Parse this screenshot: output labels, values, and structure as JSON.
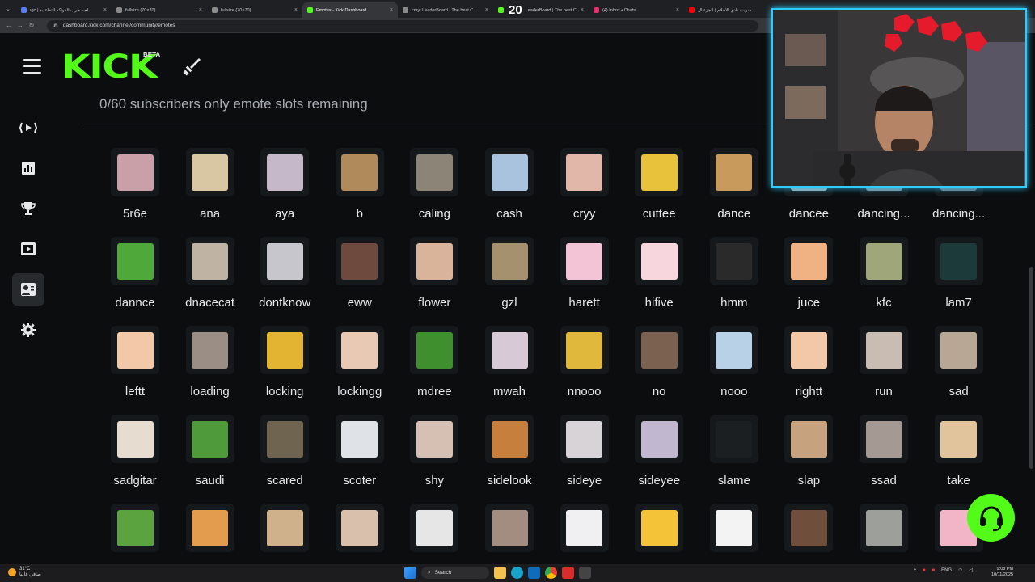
{
  "browser": {
    "tabs": [
      {
        "title": "ıgo | لعبه حرب الفواكه التفاعليه",
        "active": false,
        "color": "#5b7cfa"
      },
      {
        "title": "fullsize (70×70)",
        "active": false,
        "color": "#8a8a8a"
      },
      {
        "title": "fullsize (70×70)",
        "active": false,
        "color": "#8a8a8a"
      },
      {
        "title": "Emotes - Kick Dashboard",
        "active": true,
        "color": "#53fc18"
      },
      {
        "title": "cmyt LeaderBoard | The best C",
        "active": false,
        "color": "#8a8a8a"
      },
      {
        "title": "LeaderBoard | The best C",
        "active": false,
        "color": "#53fc18",
        "badge": "20"
      },
      {
        "title": "(4) Inbox • Chats",
        "active": false,
        "color": "#e1306c"
      },
      {
        "title": "سويت نادي الاحلام | الجزء ال",
        "active": false,
        "color": "#ff0000"
      }
    ],
    "url": "dashboard.kick.com/channel/community/emotes"
  },
  "header": {
    "logo": "KICK",
    "beta": "BETA"
  },
  "sidebar": {
    "items": [
      {
        "name": "stream-icon",
        "active": false
      },
      {
        "name": "analytics-icon",
        "active": false
      },
      {
        "name": "trophy-icon",
        "active": false
      },
      {
        "name": "video-icon",
        "active": false
      },
      {
        "name": "community-icon",
        "active": true
      },
      {
        "name": "gear-icon",
        "active": false
      }
    ]
  },
  "main": {
    "slots_text": "0/60 subscribers only emote slots remaining",
    "emotes": [
      {
        "label": "5r6e",
        "color": "#c9a0a8"
      },
      {
        "label": "ana",
        "color": "#d9c6a2"
      },
      {
        "label": "aya",
        "color": "#c4b8c9"
      },
      {
        "label": "b",
        "color": "#b08a5a"
      },
      {
        "label": "caling",
        "color": "#8c8476"
      },
      {
        "label": "cash",
        "color": "#a9c2dd"
      },
      {
        "label": "cryy",
        "color": "#e0b7a8"
      },
      {
        "label": "cuttee",
        "color": "#e8c23a"
      },
      {
        "label": "dance",
        "color": "#c89a5c"
      },
      {
        "label": "dancee",
        "color": "#9aa7b3"
      },
      {
        "label": "dancing...",
        "color": "#7f8c99"
      },
      {
        "label": "dancing...",
        "color": "#6a7580"
      },
      {
        "label": "dannce",
        "color": "#4fa83a"
      },
      {
        "label": "dnacecat",
        "color": "#bfb4a3"
      },
      {
        "label": "dontknow",
        "color": "#c6c6cc"
      },
      {
        "label": "eww",
        "color": "#6e4a3e"
      },
      {
        "label": "flower",
        "color": "#d9b49a"
      },
      {
        "label": "gzl",
        "color": "#a5916e"
      },
      {
        "label": "harett",
        "color": "#f3c4d5"
      },
      {
        "label": "hifive",
        "color": "#f7d7dd"
      },
      {
        "label": "hmm",
        "color": "#2a2a2a"
      },
      {
        "label": "juce",
        "color": "#f0b283"
      },
      {
        "label": "kfc",
        "color": "#9ea67a"
      },
      {
        "label": "lam7",
        "color": "#1c3a3a"
      },
      {
        "label": "leftt",
        "color": "#f2c9a8"
      },
      {
        "label": "loading",
        "color": "#9b8f85"
      },
      {
        "label": "locking",
        "color": "#e2b431"
      },
      {
        "label": "lockingg",
        "color": "#e8c9b3"
      },
      {
        "label": "mdree",
        "color": "#3f8f2f"
      },
      {
        "label": "mwah",
        "color": "#d7c9d6"
      },
      {
        "label": "nnooo",
        "color": "#e0b93c"
      },
      {
        "label": "no",
        "color": "#7a6150"
      },
      {
        "label": "nooo",
        "color": "#b9d1e7"
      },
      {
        "label": "rightt",
        "color": "#f2c9a8"
      },
      {
        "label": "run",
        "color": "#c9bcb3"
      },
      {
        "label": "sad",
        "color": "#b9a796"
      },
      {
        "label": "sadgitar",
        "color": "#e6dccf"
      },
      {
        "label": "saudi",
        "color": "#4f9a3b"
      },
      {
        "label": "scared",
        "color": "#6e6450"
      },
      {
        "label": "scoter",
        "color": "#dfe3e8"
      },
      {
        "label": "shy",
        "color": "#d6bfb3"
      },
      {
        "label": "sidelook",
        "color": "#c67f3c"
      },
      {
        "label": "sideye",
        "color": "#d8d3d6"
      },
      {
        "label": "sideyee",
        "color": "#c1b7cf"
      },
      {
        "label": "slame",
        "color": "#1c1f21"
      },
      {
        "label": "slap",
        "color": "#c6a27e"
      },
      {
        "label": "ssad",
        "color": "#a59a93"
      },
      {
        "label": "take",
        "color": "#e2c49c"
      },
      {
        "label": "",
        "color": "#5aa33f"
      },
      {
        "label": "",
        "color": "#e39c4d"
      },
      {
        "label": "",
        "color": "#cfb28b"
      },
      {
        "label": "",
        "color": "#d9c0ad"
      },
      {
        "label": "",
        "color": "#e6e6e6"
      },
      {
        "label": "",
        "color": "#a38d80"
      },
      {
        "label": "",
        "color": "#f0f0f3"
      },
      {
        "label": "",
        "color": "#f4c338"
      },
      {
        "label": "",
        "color": "#f3f3f3"
      },
      {
        "label": "",
        "color": "#6f4f3b"
      },
      {
        "label": "",
        "color": "#9c9f9a"
      },
      {
        "label": "",
        "color": "#f2b4c7"
      }
    ]
  },
  "taskbar": {
    "temperature": "31°C",
    "weather_text": "صافي غالبا",
    "search_placeholder": "Search",
    "lang": "ENG",
    "time": "9:08 PM",
    "date": "10/11/2025"
  },
  "colors": {
    "accent": "#53fc18",
    "webcam_border": "#2ecbff"
  }
}
